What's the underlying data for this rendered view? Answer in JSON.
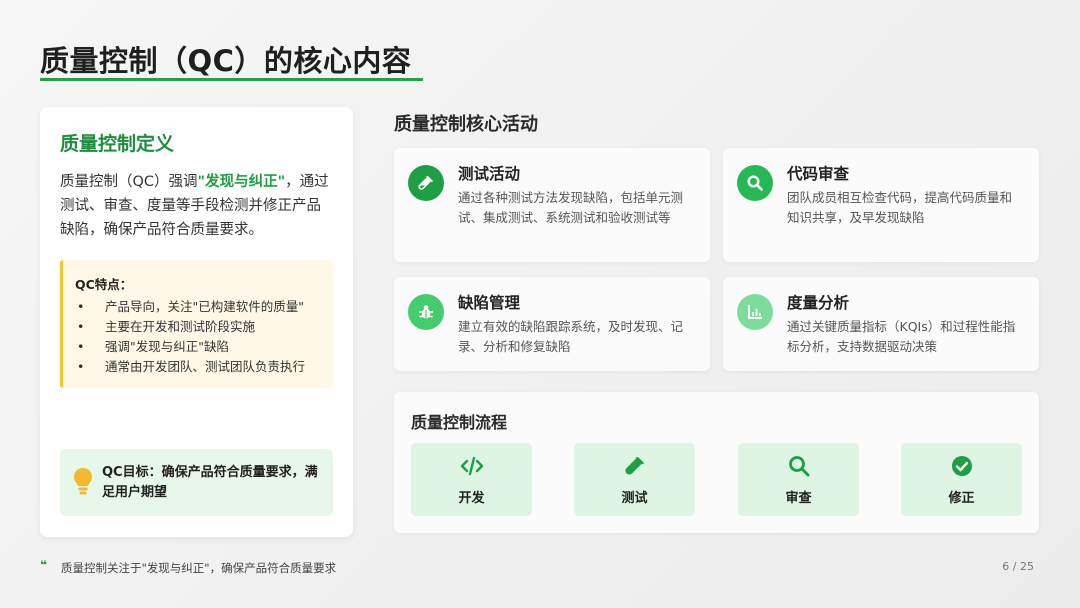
{
  "slide": {
    "title": "质量控制（QC）的核心内容"
  },
  "definition": {
    "title": "质量控制定义",
    "text_before": "质量控制（QC）强调",
    "text_highlight": "\"发现与纠正\"",
    "text_after": "，通过测试、审查、度量等手段检测并修正产品缺陷，确保产品符合质量要求。",
    "features_title": "QC特点：",
    "features": [
      "产品导向，关注\"已构建软件的质量\"",
      "主要在开发和测试阶段实施",
      "强调\"发现与纠正\"缺陷",
      "通常由开发团队、测试团队负责执行"
    ],
    "goal": "QC目标：确保产品符合质量要求，满足用户期望"
  },
  "activities": {
    "title": "质量控制核心活动",
    "items": [
      {
        "title": "测试活动",
        "desc": "通过各种测试方法发现缺陷，包括单元测试、集成测试、系统测试和验收测试等",
        "icon": "test-tube-icon",
        "color": "#1e9e45"
      },
      {
        "title": "代码审查",
        "desc": "团队成员相互检查代码，提高代码质量和知识共享，及早发现缺陷",
        "icon": "search-icon",
        "color": "#27b856"
      },
      {
        "title": "缺陷管理",
        "desc": "建立有效的缺陷跟踪系统，及时发现、记录、分析和修复缺陷",
        "icon": "bug-icon",
        "color": "#45cc6e"
      },
      {
        "title": "度量分析",
        "desc": "通过关键质量指标（KQIs）和过程性能指标分析，支持数据驱动决策",
        "icon": "chart-icon",
        "color": "#7ddc9b"
      }
    ]
  },
  "flow": {
    "title": "质量控制流程",
    "steps": [
      {
        "label": "开发",
        "icon": "code-icon"
      },
      {
        "label": "测试",
        "icon": "test-tube-icon"
      },
      {
        "label": "审查",
        "icon": "search-icon"
      },
      {
        "label": "修正",
        "icon": "check-circle-icon"
      }
    ]
  },
  "footer": {
    "quote_mark": "❝",
    "text": "质量控制关注于\"发现与纠正\"，确保产品符合质量要求",
    "page": "6 / 25"
  },
  "colors": {
    "accent": "#22a04b",
    "highlight_bg": "#fff8e6",
    "goal_bg": "#e7f7ea",
    "flow_bg": "#dff5e4"
  }
}
